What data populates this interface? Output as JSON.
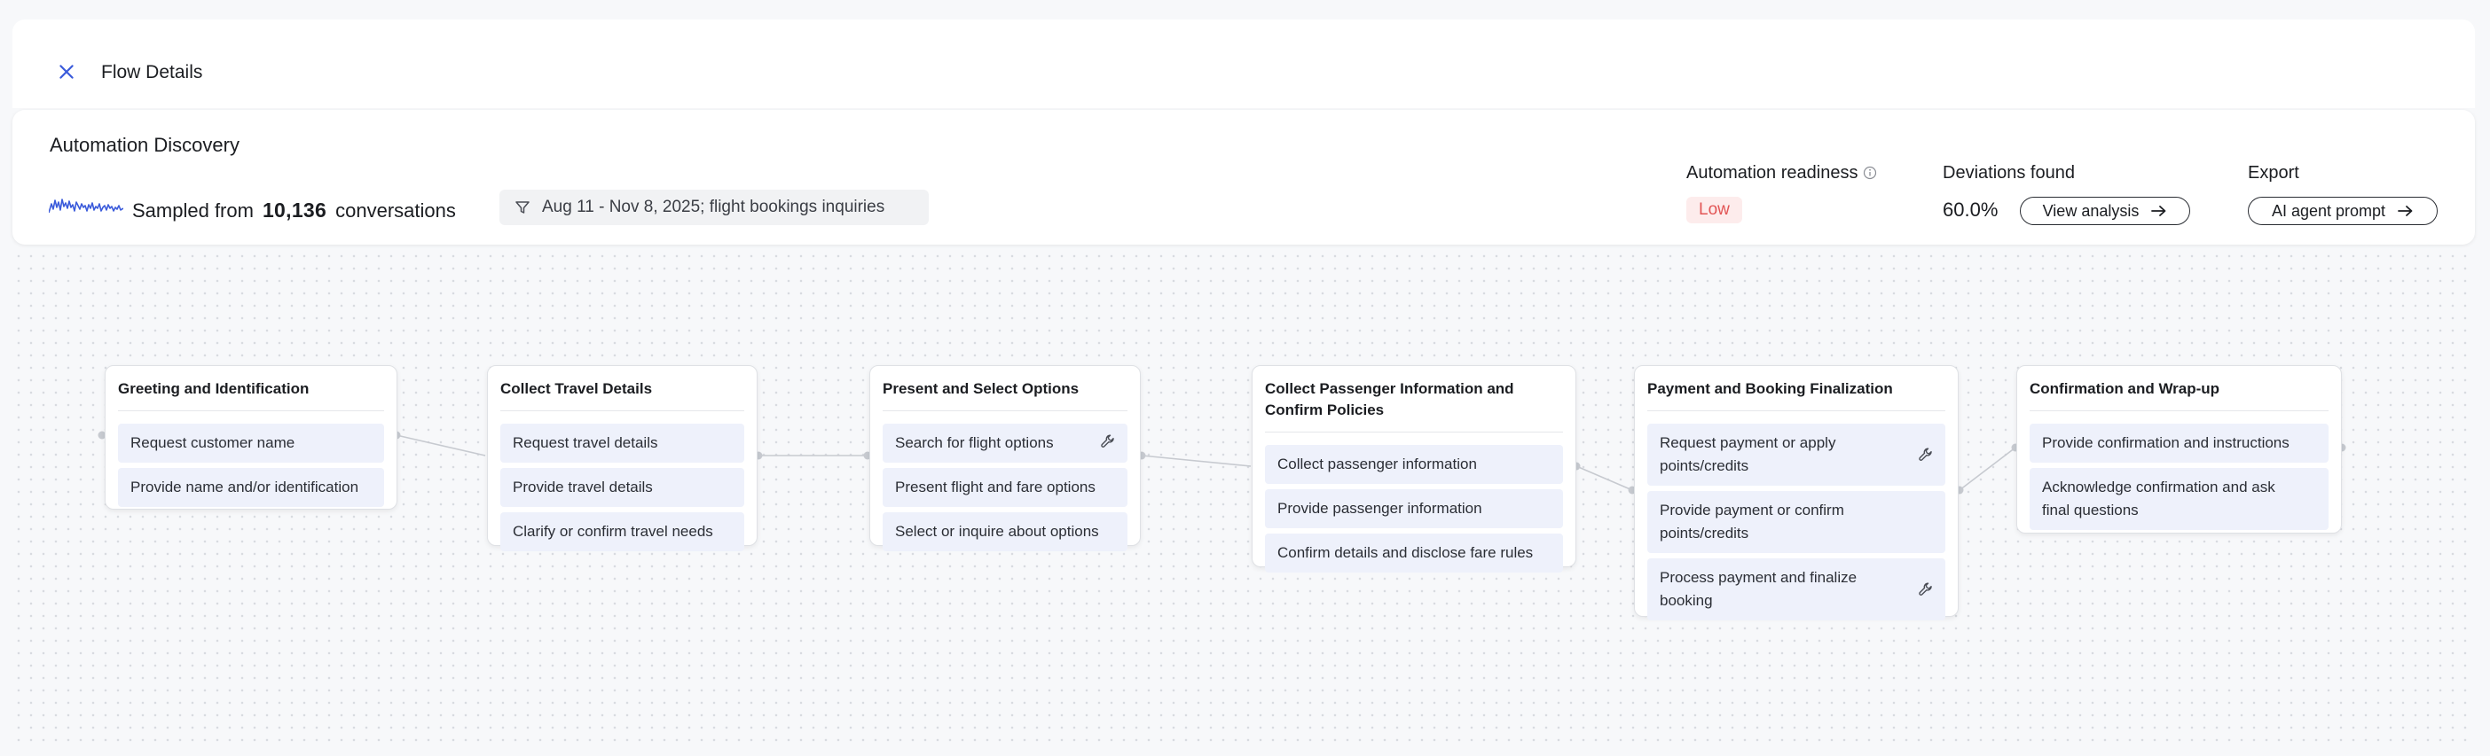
{
  "header": {
    "title": "Flow Details"
  },
  "summary": {
    "title": "Automation Discovery",
    "sampled_prefix": "Sampled from",
    "sampled_count": "10,136",
    "sampled_suffix": "conversations",
    "filter_text": "Aug 11 - Nov 8, 2025; flight bookings inquiries"
  },
  "metrics": {
    "readiness_label": "Automation readiness",
    "readiness_value": "Low",
    "deviations_label": "Deviations found",
    "deviations_value": "60.0%",
    "view_analysis_label": "View analysis",
    "export_label": "Export",
    "export_button_label": "AI agent prompt"
  },
  "colors": {
    "accent": "#3b5bdb",
    "low_badge_bg": "#fdecec",
    "low_badge_text": "#e25555",
    "step_bg": "#eef1fb"
  },
  "flow": {
    "nodes": [
      {
        "title": "Greeting and Identification",
        "steps": [
          {
            "label": "Request customer name",
            "icon": null
          },
          {
            "label": "Provide name and/or identification",
            "icon": null
          }
        ]
      },
      {
        "title": "Collect Travel Details",
        "steps": [
          {
            "label": "Request travel details",
            "icon": null
          },
          {
            "label": "Provide travel details",
            "icon": null
          },
          {
            "label": "Clarify or confirm travel needs",
            "icon": null
          }
        ]
      },
      {
        "title": "Present and Select Options",
        "steps": [
          {
            "label": "Search for flight options",
            "icon": "tool-icon"
          },
          {
            "label": "Present flight and fare options",
            "icon": null
          },
          {
            "label": "Select or inquire about options",
            "icon": null
          }
        ]
      },
      {
        "title": "Collect Passenger Information and Confirm Policies",
        "steps": [
          {
            "label": "Collect passenger information",
            "icon": null
          },
          {
            "label": "Provide passenger information",
            "icon": null
          },
          {
            "label": "Confirm details and disclose fare rules",
            "icon": null
          }
        ]
      },
      {
        "title": "Payment and Booking Finalization",
        "steps": [
          {
            "label": "Request payment or apply points/credits",
            "icon": "tool-icon"
          },
          {
            "label": "Provide payment or confirm points/credits",
            "icon": null
          },
          {
            "label": "Process payment and finalize booking",
            "icon": "tool-icon"
          }
        ]
      },
      {
        "title": "Confirmation and Wrap-up",
        "steps": [
          {
            "label": "Provide confirmation and instructions",
            "icon": null
          },
          {
            "label": "Acknowledge confirmation and ask final questions",
            "icon": null
          }
        ]
      }
    ]
  }
}
